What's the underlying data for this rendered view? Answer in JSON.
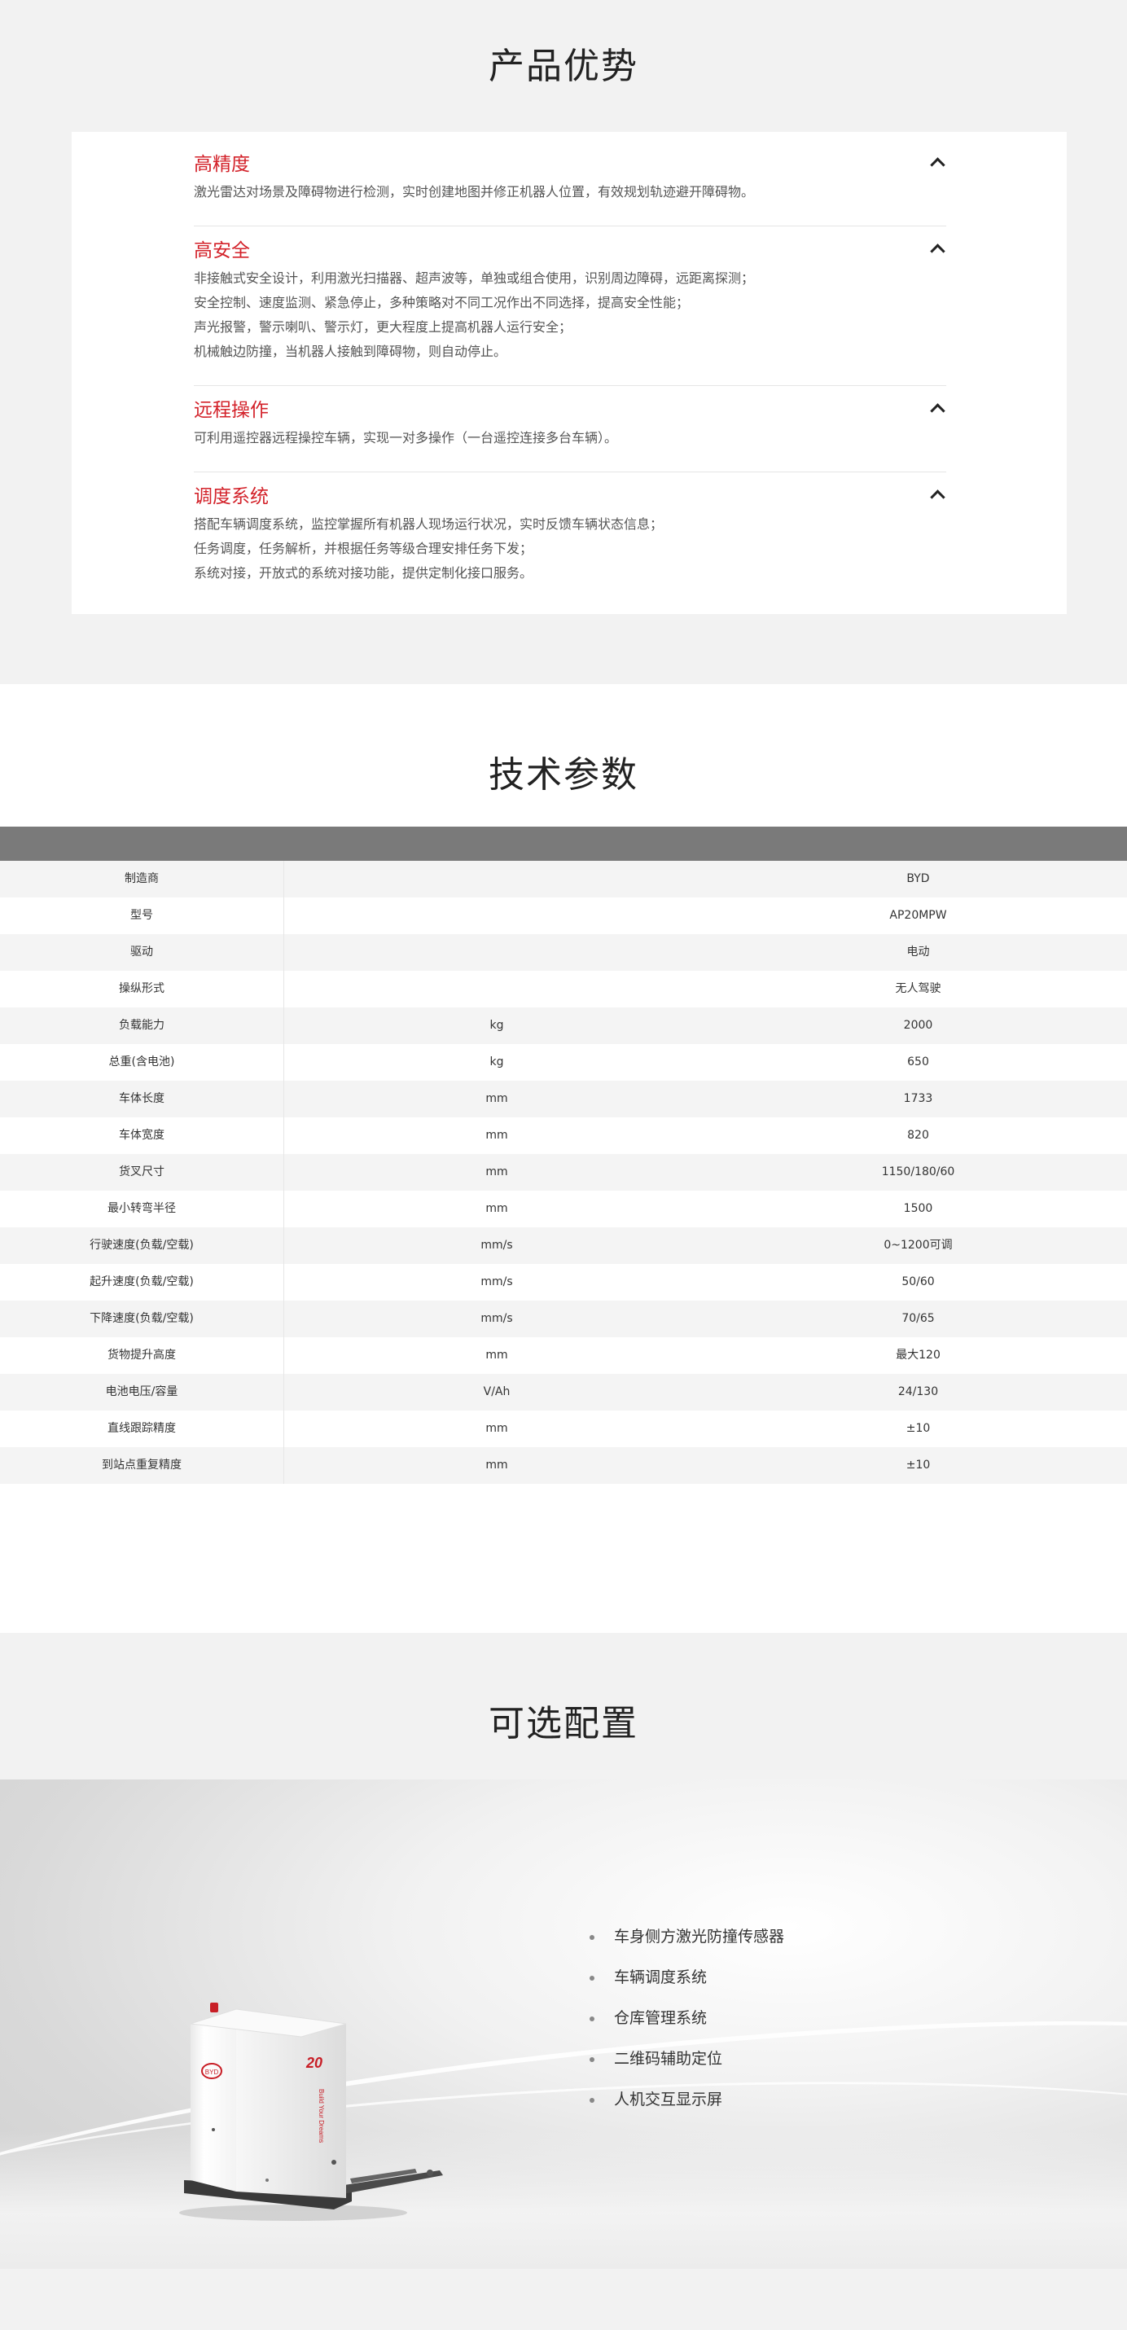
{
  "advantages": {
    "title": "产品优势",
    "items": [
      {
        "title": "高精度",
        "lines": [
          "激光雷达对场景及障碍物进行检测，实时创建地图并修正机器人位置，有效规划轨迹避开障碍物。"
        ]
      },
      {
        "title": "高安全",
        "lines": [
          "非接触式安全设计，利用激光扫描器、超声波等，单独或组合使用，识别周边障碍，远距离探测；",
          "安全控制、速度监测、紧急停止，多种策略对不同工况作出不同选择，提高安全性能；",
          "声光报警，警示喇叭、警示灯，更大程度上提高机器人运行安全；",
          "机械触边防撞，当机器人接触到障碍物，则自动停止。"
        ]
      },
      {
        "title": "远程操作",
        "lines": [
          "可利用遥控器远程操控车辆，实现一对多操作（一台遥控连接多台车辆）。"
        ]
      },
      {
        "title": "调度系统",
        "lines": [
          "搭配车辆调度系统，监控掌握所有机器人现场运行状况，实时反馈车辆状态信息；",
          "任务调度，任务解析，并根据任务等级合理安排任务下发；",
          "系统对接，开放式的系统对接功能，提供定制化接口服务。"
        ]
      }
    ]
  },
  "specs": {
    "title": "技术参数",
    "rows": [
      {
        "name": "制造商",
        "unit": "",
        "value": "BYD"
      },
      {
        "name": "型号",
        "unit": "",
        "value": "AP20MPW"
      },
      {
        "name": "驱动",
        "unit": "",
        "value": "电动"
      },
      {
        "name": "操纵形式",
        "unit": "",
        "value": "无人驾驶"
      },
      {
        "name": "负载能力",
        "unit": "kg",
        "value": "2000"
      },
      {
        "name": "总重(含电池)",
        "unit": "kg",
        "value": "650"
      },
      {
        "name": "车体长度",
        "unit": "mm",
        "value": "1733"
      },
      {
        "name": "车体宽度",
        "unit": "mm",
        "value": "820"
      },
      {
        "name": "货叉尺寸",
        "unit": "mm",
        "value": "1150/180/60"
      },
      {
        "name": "最小转弯半径",
        "unit": "mm",
        "value": "1500"
      },
      {
        "name": "行驶速度(负载/空载)",
        "unit": "mm/s",
        "value": "0~1200可调"
      },
      {
        "name": "起升速度(负载/空载)",
        "unit": "mm/s",
        "value": "50/60"
      },
      {
        "name": "下降速度(负载/空载)",
        "unit": "mm/s",
        "value": "70/65"
      },
      {
        "name": "货物提升高度",
        "unit": "mm",
        "value": "最大120"
      },
      {
        "name": "电池电压/容量",
        "unit": "V/Ah",
        "value": "24/130"
      },
      {
        "name": "直线跟踪精度",
        "unit": "mm",
        "value": "±10"
      },
      {
        "name": "到站点重复精度",
        "unit": "mm",
        "value": "±10"
      }
    ]
  },
  "options": {
    "title": "可选配置",
    "items": [
      "车身侧方激光防撞传感器",
      "车辆调度系统",
      "仓库管理系统",
      "二维码辅助定位",
      "人机交互显示屏"
    ],
    "robot": {
      "logo_text": "BYD",
      "model_number": "20",
      "slogan": "Build Your Dreams"
    }
  },
  "colors": {
    "accent": "#d3222a",
    "table_header": "#7a7a7a",
    "row_alt": "#f4f4f4"
  }
}
